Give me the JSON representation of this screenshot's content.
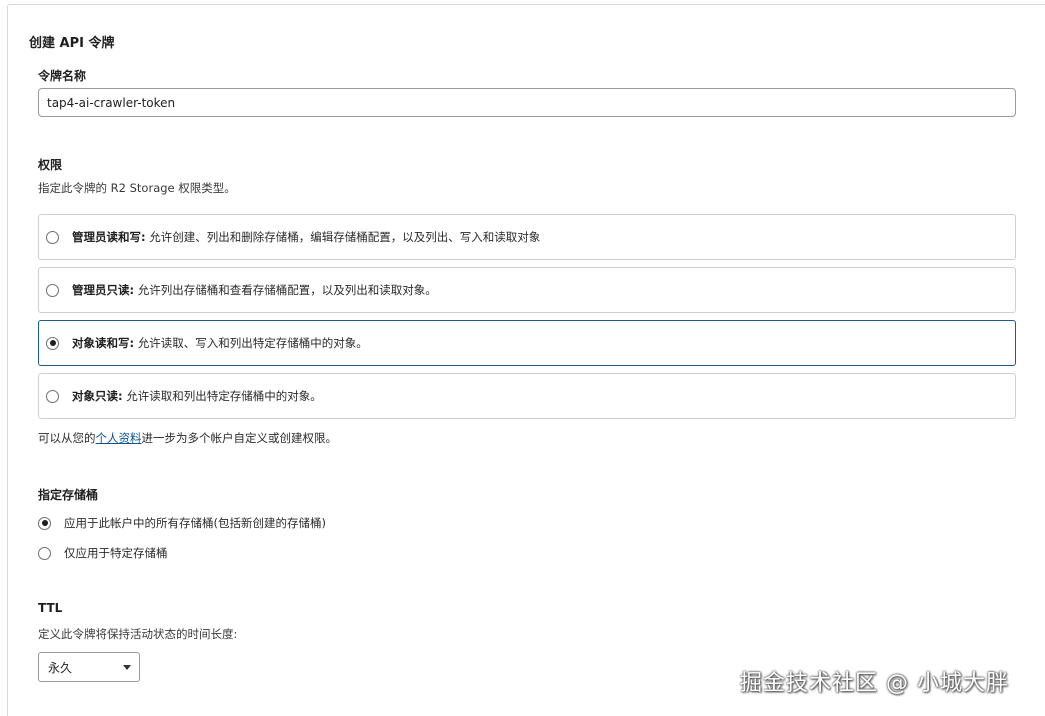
{
  "page_title": "创建 API 令牌",
  "token_name": {
    "label": "令牌名称",
    "value": "tap4-ai-crawler-token"
  },
  "permissions": {
    "label": "权限",
    "description": "指定此令牌的 R2 Storage 权限类型。",
    "options": [
      {
        "title": "管理员读和写:",
        "desc": " 允许创建、列出和删除存储桶，编辑存储桶配置，以及列出、写入和读取对象",
        "selected": false
      },
      {
        "title": "管理员只读:",
        "desc": " 允许列出存储桶和查看存储桶配置，以及列出和读取对象。",
        "selected": false
      },
      {
        "title": "对象读和写:",
        "desc": " 允许读取、写入和列出特定存储桶中的对象。",
        "selected": true
      },
      {
        "title": "对象只读:",
        "desc": " 允许读取和列出特定存储桶中的对象。",
        "selected": false
      }
    ],
    "note_prefix": "可以从您的",
    "note_link": "个人资料",
    "note_suffix": "进一步为多个帐户自定义或创建权限。"
  },
  "bucket_scope": {
    "label": "指定存储桶",
    "options": [
      {
        "label": "应用于此帐户中的所有存储桶(包括新创建的存储桶)",
        "selected": true
      },
      {
        "label": "仅应用于特定存储桶",
        "selected": false
      }
    ]
  },
  "ttl": {
    "label": "TTL",
    "description": "定义此令牌将保持活动状态的时间长度:",
    "selected_value": "永久",
    "icon": "chevron-down-icon"
  },
  "watermark": "掘金技术社区 @ 小城大胖"
}
